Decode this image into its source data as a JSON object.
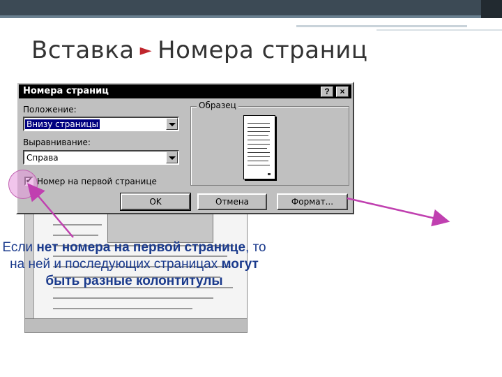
{
  "slide": {
    "title_part1": "Вставка",
    "title_sep": "►",
    "title_part2": "Номера страниц"
  },
  "dialog": {
    "title": "Номера страниц",
    "help_button": "?",
    "close_button": "×",
    "position_label": "Положение:",
    "position_value": "Внизу страницы",
    "alignment_label": "Выравнивание:",
    "alignment_value": "Справа",
    "preview_label": "Образец",
    "first_page_checkbox_label": "Номер на первой странице",
    "first_page_checked": "✔",
    "ok_button": "OK",
    "cancel_button": "Отмена",
    "format_button": "Формат..."
  },
  "caption": {
    "part1": "Если ",
    "part2": "нет номера на первой странице",
    "part3": ", то на ней и последующих страницах ",
    "part4": "могут быть разные колонтитулы"
  },
  "colors": {
    "arrow": "#c040b0",
    "caption": "#1a3a8c",
    "title_arrow": "#c0262d"
  }
}
